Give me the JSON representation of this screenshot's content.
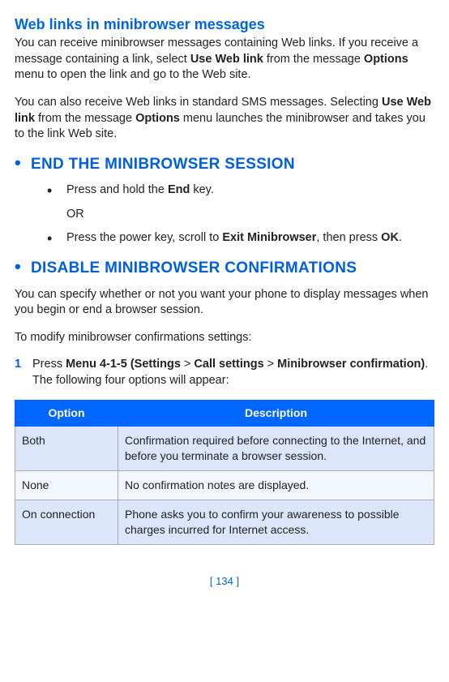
{
  "section1": {
    "heading": "Web links in minibrowser messages",
    "para1_a": "You can receive minibrowser messages containing Web links. If you receive a message containing a link, select ",
    "para1_b": "Use Web link",
    "para1_c": " from the message ",
    "para1_d": "Options",
    "para1_e": " menu to open the link and go to the Web site.",
    "para2_a": "You can also receive Web links in standard SMS messages. Selecting ",
    "para2_b": "Use Web link",
    "para2_c": " from the message ",
    "para2_d": "Options",
    "para2_e": " menu launches the minibrowser and takes you to the link Web site."
  },
  "section2": {
    "bullet": "•",
    "heading": "END THE MINIBROWSER SESSION",
    "item1_a": "Press and hold the ",
    "item1_b": "End",
    "item1_c": " key.",
    "or": "OR",
    "item2_a": "Press the power key, scroll to ",
    "item2_b": "Exit Minibrowser",
    "item2_c": ", then press ",
    "item2_d": "OK",
    "item2_e": "."
  },
  "section3": {
    "bullet": "•",
    "heading": "DISABLE MINIBROWSER CONFIRMATIONS",
    "para1": "You can specify whether or not you want your phone to display messages when you begin or end a browser session.",
    "para2": "To modify minibrowser confirmations settings:",
    "step_num": "1",
    "step_a": "Press ",
    "step_b": "Menu 4-1-5 (Settings",
    "step_c": " > ",
    "step_d": "Call settings",
    "step_e": " > ",
    "step_f": "Minibrowser confirmation)",
    "step_g": ". The following four options will appear:"
  },
  "table": {
    "head_option": "Option",
    "head_desc": "Description",
    "rows": [
      {
        "opt": "Both",
        "desc": "Confirmation required before connecting to the Internet, and before you terminate a browser session."
      },
      {
        "opt": "None",
        "desc": "No confirmation notes are displayed."
      },
      {
        "opt": "On connection",
        "desc": "Phone asks you to confirm your awareness to possible charges incurred for Internet access."
      }
    ]
  },
  "footer": "[ 134 ]"
}
